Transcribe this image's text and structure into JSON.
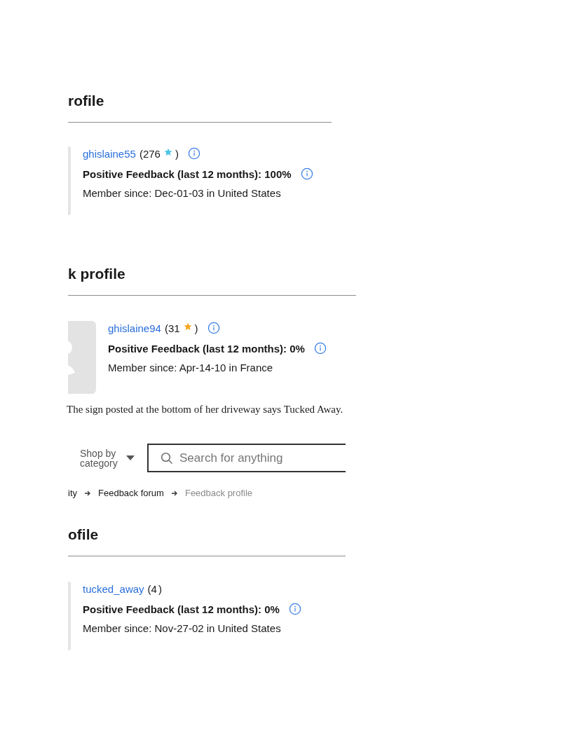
{
  "clips": [
    {
      "kind": "profile",
      "heading": "rofile",
      "avatar": false,
      "name": "ghislaine55",
      "score": "(276",
      "color": "#4cc2e4",
      "score_close": ")",
      "name_info": true,
      "feedback": "Positive Feedback (last 12 months): 100%",
      "feedback_info": true,
      "member": "Member since: Dec-01-03 in United States"
    },
    {
      "kind": "profile",
      "heading": "k profile",
      "avatar": true,
      "name": "ghislaine94",
      "score": "(31",
      "color": "#f5a623",
      "score_close": ")",
      "name_info": true,
      "feedback": "Positive Feedback (last 12 months): 0%",
      "feedback_info": true,
      "member": "Member since: Apr-14-10 in France"
    },
    {
      "kind": "caption",
      "text": "The sign posted at the bottom of her driveway says Tucked Away."
    },
    {
      "kind": "header",
      "shop_by": "Shop by category",
      "search_placeholder": "Search for anything",
      "breadcrumb": [
        {
          "label": "ity",
          "current": false
        },
        {
          "label": "Feedback forum",
          "current": false
        },
        {
          "label": "Feedback profile",
          "current": true
        }
      ]
    },
    {
      "kind": "profile",
      "heading": "ofile",
      "avatar": false,
      "name": "tucked_away",
      "score": "(4",
      "score_close": ")",
      "name_info": false,
      "feedback": "Positive Feedback (last 12 months): 0%",
      "feedback_info": true,
      "member": "Member since: Nov-27-02 in United States"
    }
  ]
}
